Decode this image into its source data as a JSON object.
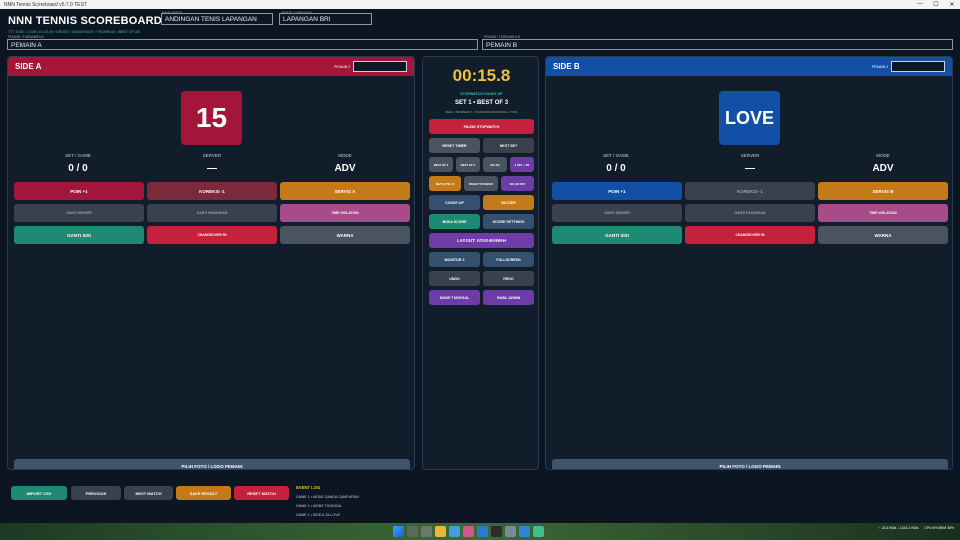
{
  "window": {
    "title": "NNN Tennis Scoreboard v5.7.0 TEST",
    "controls": [
      "—",
      "☐",
      "✕"
    ]
  },
  "header": {
    "title": "NNN TENNIS SCOREBOARD",
    "subtitle": "TTT 2026 • LOVE) 15-30-40 • DEUCE / ADVANTAGE • TIE-BREAK • BEST OF 3/5",
    "event_label": "NAMA EVENT",
    "event_value": "ANDINGAN TENIS LAPANGAN",
    "venue_label": "VENUE / LAPANGAN",
    "venue_value": "LAPANGAN BRI",
    "player_a_label": "PEMAIN / TURNAMEN A",
    "player_a_value": "PEMAIN A",
    "player_b_label": "PEMAIN / TURNAMEN B",
    "player_b_value": "PEMAIN B"
  },
  "side_a": {
    "name": "SIDE A",
    "player2_label": "PEMAIN 2",
    "score": "15",
    "stats": [
      {
        "label": "SET / GAME",
        "value": "0 / 0"
      },
      {
        "label": "SERVER",
        "value": "—"
      },
      {
        "label": "MODE",
        "value": "ADV"
      }
    ],
    "buttons": [
      "POIN +1",
      "KOREKSI -1",
      "SERVIS A",
      "GANTI SERVER",
      "GANTI PASANGAN",
      "TIME VIOLATION",
      "GANTI SISI",
      "CHANGEOVER 90",
      "WARNA"
    ],
    "photo_button": "PILIH FOTO / LOGO PEMAIN",
    "color": "#a3163a"
  },
  "side_b": {
    "name": "SIDE B",
    "player2_label": "PEMAIN 2",
    "score": "LOVE",
    "stats": [
      {
        "label": "SET / GAME",
        "value": "0 / 0"
      },
      {
        "label": "SERVER",
        "value": "—"
      },
      {
        "label": "MODE",
        "value": "ADV"
      }
    ],
    "buttons": [
      "POIN +1",
      "KOREKSI -1",
      "SERVIS B",
      "GANTI SERVER",
      "GANTI PASANGAN",
      "TIME VIOLATION",
      "GANTI SISI",
      "CHANGEOVER 90",
      "WARNA"
    ],
    "photo_button": "PILIH FOTO / LOGO PEMAIN",
    "color": "#1250a8"
  },
  "center": {
    "timer": "00:15.8",
    "timer_mode": "STOPWATCH COUNT-UP",
    "set_info": "SET 1 • BEST OF 3",
    "set_sub": "DEFA • TIE-BREAK 7 • STANDARD ADVANTAGE • TODS",
    "buttons": {
      "pause": "PAUSE STOPWATCH",
      "reset_timer": "RESET TIMER",
      "next_set": "NEXT SET",
      "best3": "BEST OF 3",
      "best5": "BEST OF 5",
      "noad": "NO-AD",
      "set_tb": "3 SET + TB",
      "match_tb": "MATCH TB 10",
      "reset_standard": "RESET STANDAR",
      "noad_off": "NO-AD OFF",
      "count_up": "COUNT-UP",
      "buzzer": "BUZZER",
      "buka_score": "BUKA SCORE",
      "score_settings": "SCORE SETTINGS",
      "layout": "LAYOUT: ATAS-BAWAH",
      "monitor": "MONITOR 2",
      "fullscreen": "FULLSCREEN",
      "undo": "UNDO",
      "redo": "REDO",
      "mode_tunggal": "MODE TUNGGAL",
      "hasil_admin": "HASIL ADMIN"
    }
  },
  "footer": {
    "buttons": [
      "IMPORT CSV",
      "PREVIOUS",
      "NEXT MATCH",
      "SAVE RESULT",
      "RESET MATCH"
    ],
    "event_log_title": "EVENT LOG",
    "event_log": [
      "GAME 1 • MODE GANDA CAMPURAN",
      "GAME 1 • MODE TUNGGAL",
      "GAME 1 • SIDE A 15-LOVE"
    ]
  },
  "taskbar": {
    "net": "↑ 23.4 KB/s  ↓ 1341.2 KB/s",
    "cpu": "CPU 6%  MEM 38%",
    "icons": [
      "start-icon",
      "search-icon",
      "task-view-icon",
      "file-explorer-icon",
      "browser-icon",
      "photos-icon",
      "mail-icon",
      "terminal-icon",
      "settings-icon",
      "store-icon",
      "app-icon"
    ]
  }
}
